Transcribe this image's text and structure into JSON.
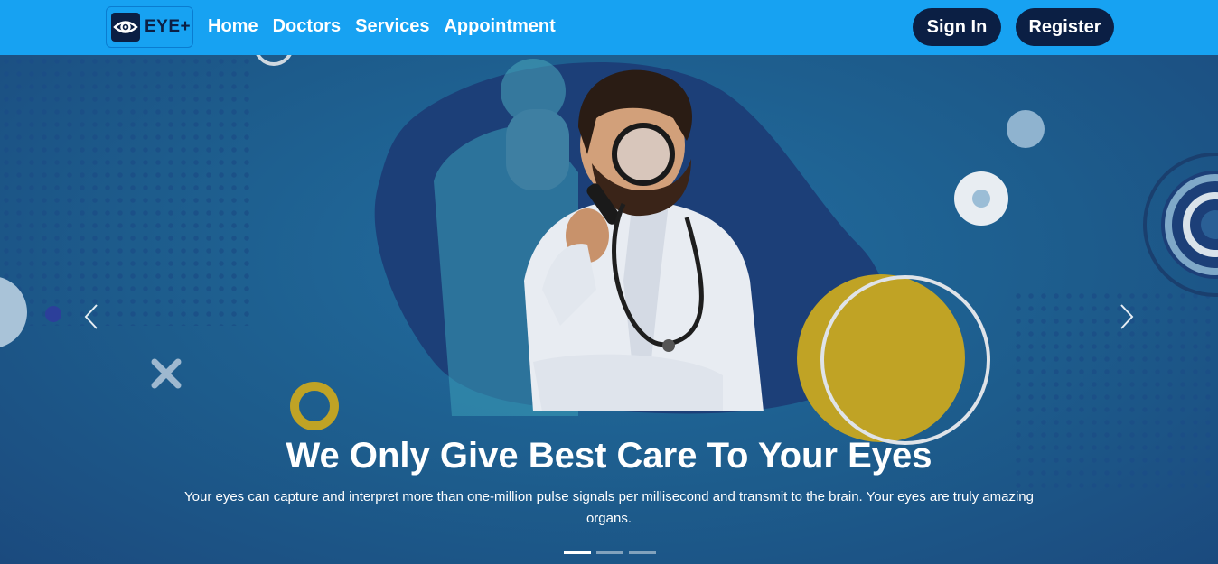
{
  "brand": {
    "logo_text": "EYE+",
    "logo_icon": "eye-icon"
  },
  "nav": {
    "links": [
      "Home",
      "Doctors",
      "Services",
      "Appointment"
    ],
    "sign_in": "Sign In",
    "register": "Register"
  },
  "hero": {
    "headline": "We Only Give Best Care To Your Eyes",
    "subtext": "Your eyes can capture and interpret more than one-million pulse signals per millisecond and transmit to the brain. Your eyes are truly amazing organs.",
    "prev_icon": "chevron-left-icon",
    "next_icon": "chevron-right-icon",
    "slides_total": 3,
    "slide_active": 1
  },
  "colors": {
    "navbar": "#17a2f2",
    "button": "#0b1f44",
    "hero_bg": "#1e5a8a",
    "accent_yellow": "#c0a325"
  }
}
